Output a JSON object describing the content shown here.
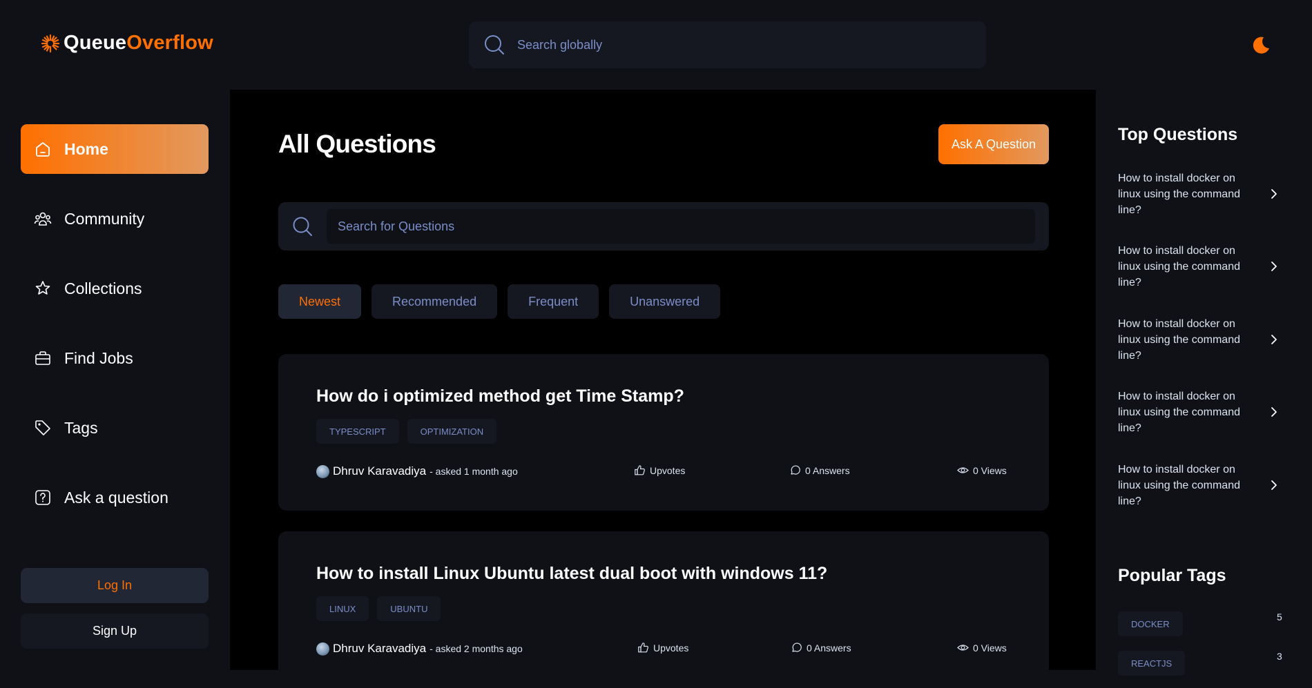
{
  "brand": {
    "name_part1": "Queue",
    "name_part2": "Overflow",
    "accent_color": "#ff7000"
  },
  "header": {
    "search_placeholder": "Search globally",
    "theme_icon": "moon-icon"
  },
  "sidebar": {
    "items": [
      {
        "label": "Home",
        "icon": "home-icon",
        "active": true
      },
      {
        "label": "Community",
        "icon": "community-icon"
      },
      {
        "label": "Collections",
        "icon": "star-icon"
      },
      {
        "label": "Find Jobs",
        "icon": "briefcase-icon"
      },
      {
        "label": "Tags",
        "icon": "tag-icon"
      },
      {
        "label": "Ask a question",
        "icon": "question-icon"
      }
    ],
    "login_label": "Log In",
    "signup_label": "Sign Up"
  },
  "main": {
    "title": "All Questions",
    "ask_button": "Ask A Question",
    "search_placeholder": "Search for Questions",
    "filters": [
      {
        "label": "Newest",
        "active": true
      },
      {
        "label": "Recommended"
      },
      {
        "label": "Frequent"
      },
      {
        "label": "Unanswered"
      }
    ],
    "questions": [
      {
        "title": "How do i optimized method get Time Stamp?",
        "tags": [
          "TYPESCRIPT",
          "OPTIMIZATION"
        ],
        "author": "Dhruv Karavadiya",
        "asked": "- asked 1 month ago",
        "upvotes": "Upvotes",
        "answers": "0 Answers",
        "views": "0 Views"
      },
      {
        "title": "How to install Linux Ubuntu latest dual boot with windows 11?",
        "tags": [
          "LINUX",
          "UBUNTU"
        ],
        "author": "Dhruv Karavadiya",
        "asked": "- asked 2 months ago",
        "upvotes": "Upvotes",
        "answers": "0 Answers",
        "views": "0 Views"
      }
    ]
  },
  "right_sidebar": {
    "top_questions_title": "Top Questions",
    "top_questions": [
      "How to install docker on linux using the command line?",
      "How to install docker on linux using the command line?",
      "How to install docker on linux using the command line?",
      "How to install docker on linux using the command line?",
      "How to install docker on linux using the command line?"
    ],
    "popular_tags_title": "Popular Tags",
    "popular_tags": [
      {
        "name": "DOCKER",
        "count": "5"
      },
      {
        "name": "REACTJS",
        "count": "3"
      }
    ]
  }
}
